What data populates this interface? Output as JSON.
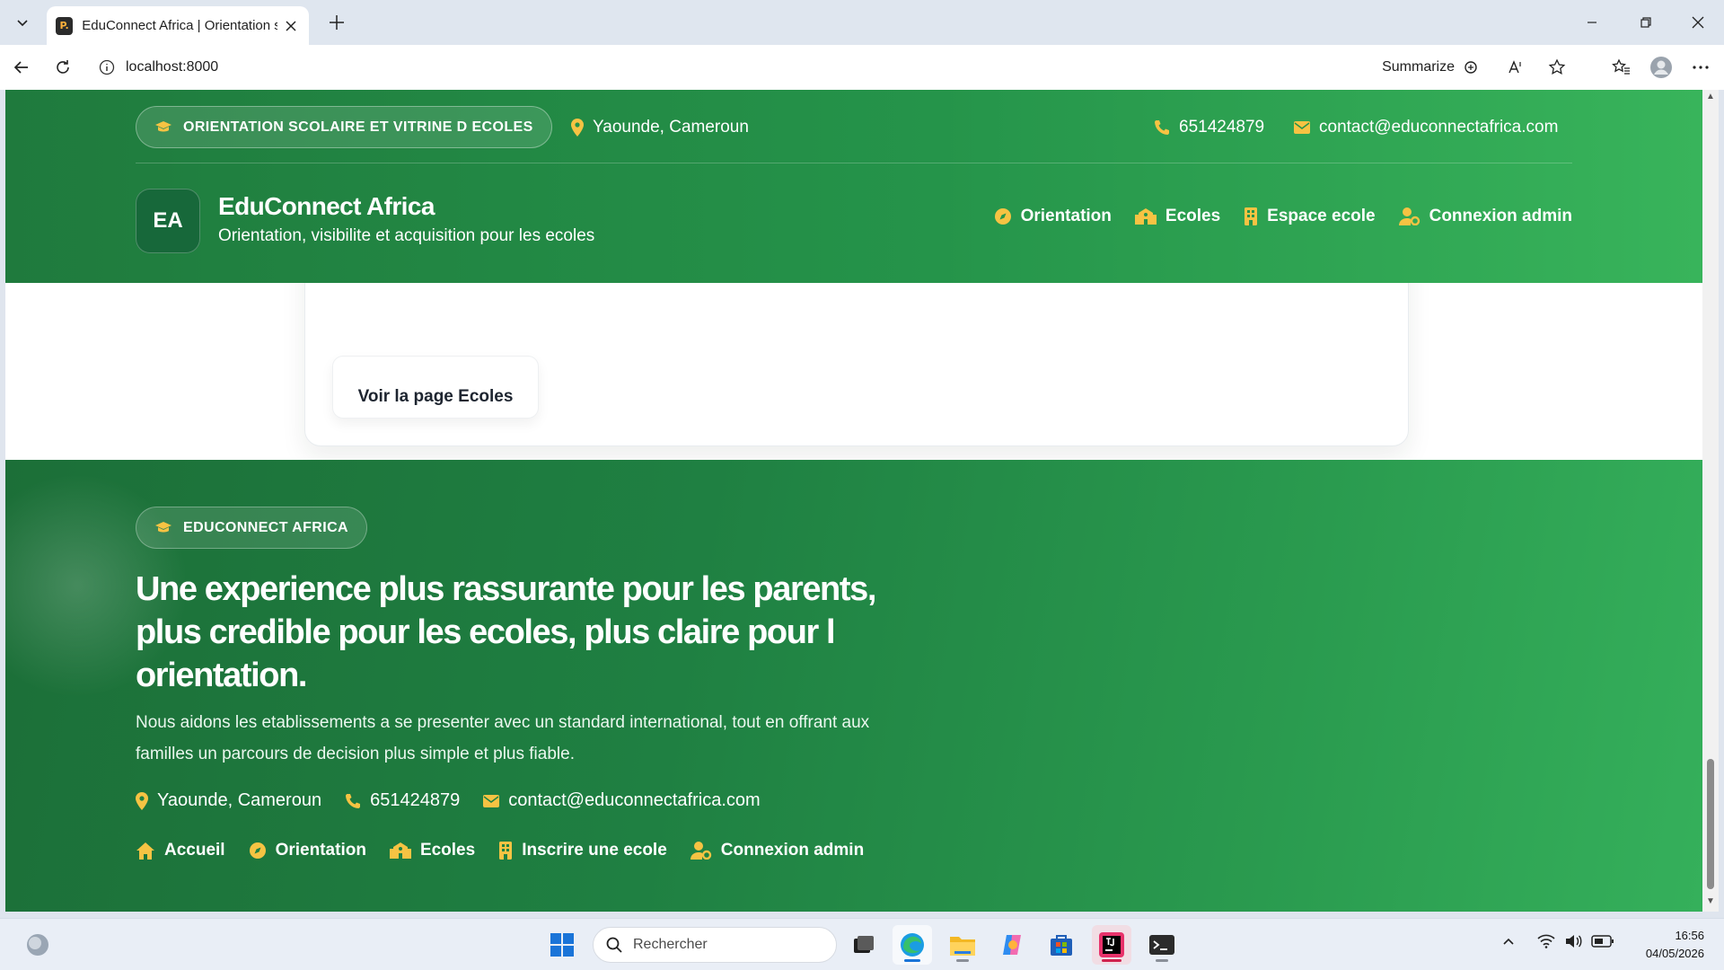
{
  "browser": {
    "tab_title": "EduConnect Africa | Orientation scolaire",
    "favicon_text": "P.",
    "url": "localhost:8000",
    "summarize_label": "Summarize"
  },
  "header": {
    "badge": "ORIENTATION SCOLAIRE ET VITRINE D ECOLES",
    "location": "Yaounde, Cameroun",
    "phone": "651424879",
    "email": "contact@educonnectafrica.com",
    "logo": "EA",
    "brand_name": "EduConnect Africa",
    "brand_tagline": "Orientation, visibilite et acquisition pour les ecoles",
    "nav": [
      {
        "label": "Orientation",
        "icon": "compass-icon"
      },
      {
        "label": "Ecoles",
        "icon": "school-icon"
      },
      {
        "label": "Espace ecole",
        "icon": "building-icon"
      },
      {
        "label": "Connexion admin",
        "icon": "user-gear-icon"
      }
    ]
  },
  "card": {
    "button_label": "Voir la page Ecoles"
  },
  "footer": {
    "badge": "EDUCONNECT AFRICA",
    "title": "Une experience plus rassurante pour les parents, plus credible pour les ecoles, plus claire pour l orientation.",
    "description": "Nous aidons les etablissements a se presenter avec un standard international, tout en offrant aux familles un parcours de decision plus simple et plus fiable.",
    "location": "Yaounde, Cameroun",
    "phone": "651424879",
    "email": "contact@educonnectafrica.com",
    "links": [
      {
        "label": "Accueil",
        "icon": "home-icon"
      },
      {
        "label": "Orientation",
        "icon": "compass-icon"
      },
      {
        "label": "Ecoles",
        "icon": "school-icon"
      },
      {
        "label": "Inscrire une ecole",
        "icon": "building-icon"
      },
      {
        "label": "Connexion admin",
        "icon": "user-gear-icon"
      }
    ]
  },
  "taskbar": {
    "search_placeholder": "Rechercher",
    "time": "16:56",
    "date": "04/05/2026"
  },
  "colors": {
    "accent_icon": "#f6c343",
    "header_green": "#25944a",
    "footer_green": "#1f8042"
  }
}
